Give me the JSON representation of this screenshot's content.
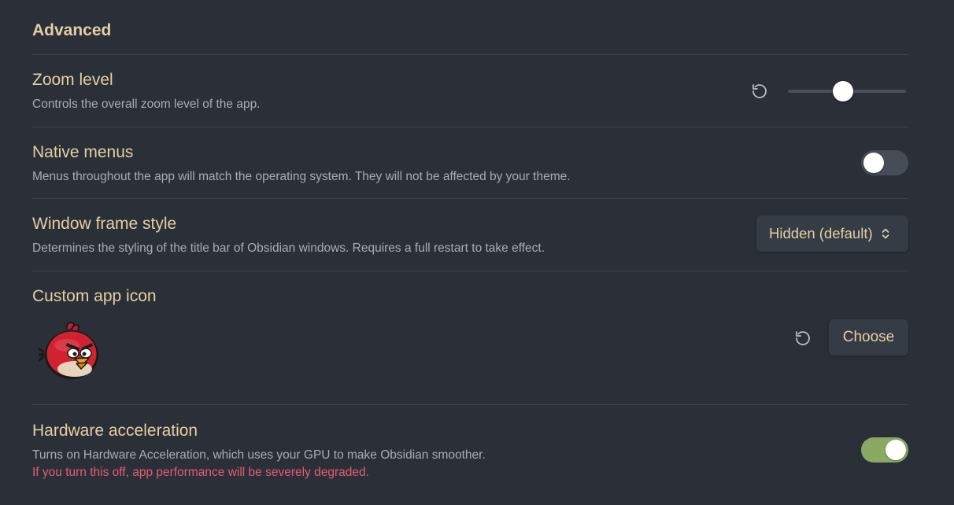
{
  "section": {
    "title": "Advanced"
  },
  "settings": {
    "zoom": {
      "name": "Zoom level",
      "description": "Controls the overall zoom level of the app.",
      "reset_icon": "reset-icon",
      "slider_value": 0.46
    },
    "native_menus": {
      "name": "Native menus",
      "description": "Menus throughout the app will match the operating system. They will not be affected by your theme.",
      "enabled": false
    },
    "window_frame": {
      "name": "Window frame style",
      "description": "Determines the styling of the title bar of Obsidian windows. Requires a full restart to take effect.",
      "selected": "Hidden (default)"
    },
    "app_icon": {
      "name": "Custom app icon",
      "icon": "angry-bird-icon",
      "reset_icon": "reset-icon",
      "choose_label": "Choose"
    },
    "hardware": {
      "name": "Hardware acceleration",
      "description": "Turns on Hardware Acceleration, which uses your GPU to make Obsidian smoother.",
      "warning": "If you turn this off, app performance will be severely degraded.",
      "enabled": true
    }
  },
  "colors": {
    "background": "#2b3038",
    "heading": "#e3cfa3",
    "description": "#a8adb4",
    "warning": "#e85a6e",
    "toggle_on": "#8aa962",
    "toggle_off": "#474d56"
  }
}
